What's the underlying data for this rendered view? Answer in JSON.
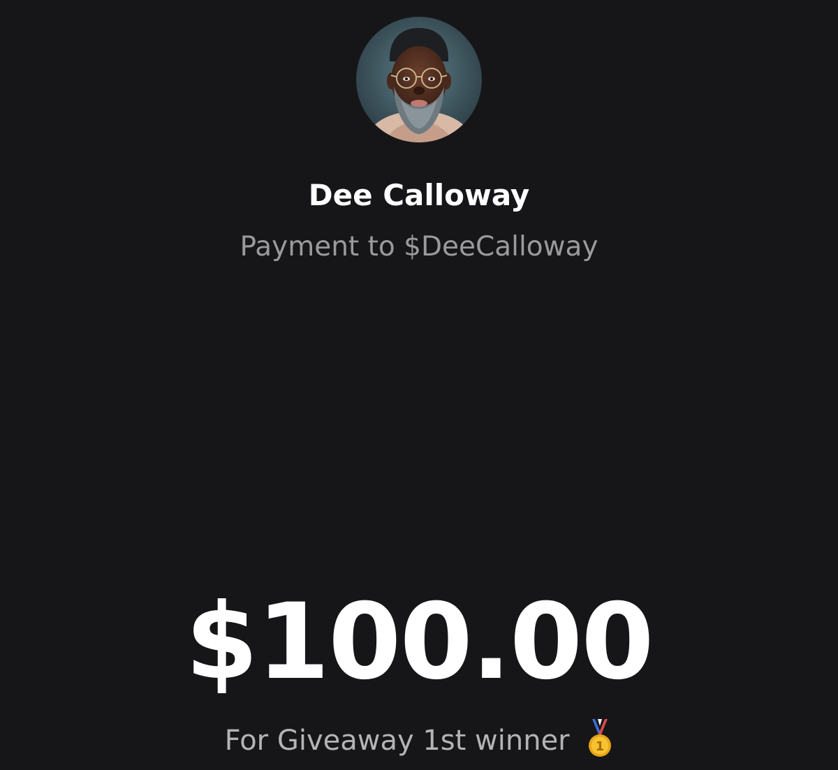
{
  "recipient": {
    "name": "Dee Calloway",
    "subtitle": "Payment to $DeeCalloway",
    "avatar_icon": "profile-photo"
  },
  "payment": {
    "amount": "$100.00",
    "note": "For Giveaway 1st winner",
    "note_icon": "first-place-medal-icon"
  },
  "colors": {
    "background": "#161618",
    "primary_text": "#ffffff",
    "secondary_text": "#9a9a9e"
  }
}
